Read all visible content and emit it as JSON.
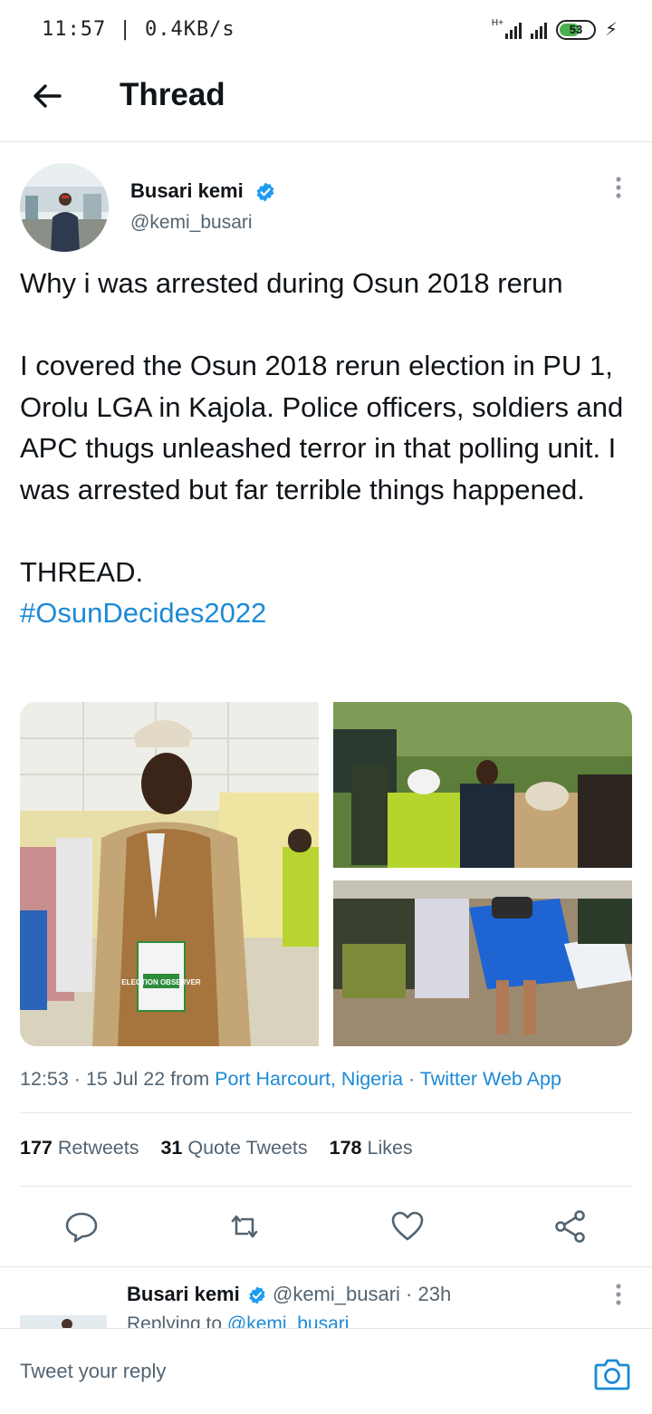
{
  "status_bar": {
    "time": "11:57 | 0.4KB/s",
    "network": "H+",
    "battery": "53"
  },
  "header": {
    "title": "Thread"
  },
  "tweet": {
    "author_name": "Busari kemi",
    "author_handle": "@kemi_busari",
    "paragraph1": "Why i was arrested during Osun 2018 rerun",
    "paragraph2": "I covered the Osun 2018 rerun election in PU 1, Orolu LGA in Kajola. Police officers, soldiers and APC thugs unleashed terror in that polling unit. I was arrested but far terrible things happened.",
    "paragraph3": "THREAD.",
    "hashtag": "#OsunDecides2022",
    "vest_text": "ELECTION OBSERVER",
    "time": "12:53 · 15 Jul 22 from ",
    "location": "Port Harcourt, Nigeria",
    "separator": " · ",
    "source": "Twitter Web App",
    "retweets": "177",
    "retweets_label": "Retweets",
    "quotes": "31",
    "quotes_label": "Quote Tweets",
    "likes": "178",
    "likes_label": "Likes"
  },
  "reply": {
    "author_name": "Busari kemi",
    "author_handle": "@kemi_busari",
    "time": "· 23h",
    "replying_prefix": "Replying to ",
    "replying_handle": "@kemi_busari"
  },
  "composer": {
    "placeholder": "Tweet your reply"
  },
  "colors": {
    "accent": "#1d8ad6",
    "verified": "#1d9bf0",
    "text": "#0f1419",
    "muted": "#536471"
  },
  "icons": [
    "back-arrow-icon",
    "verified-badge-icon",
    "more-vertical-icon",
    "reply-icon",
    "retweet-icon",
    "like-icon",
    "share-icon",
    "camera-icon"
  ]
}
